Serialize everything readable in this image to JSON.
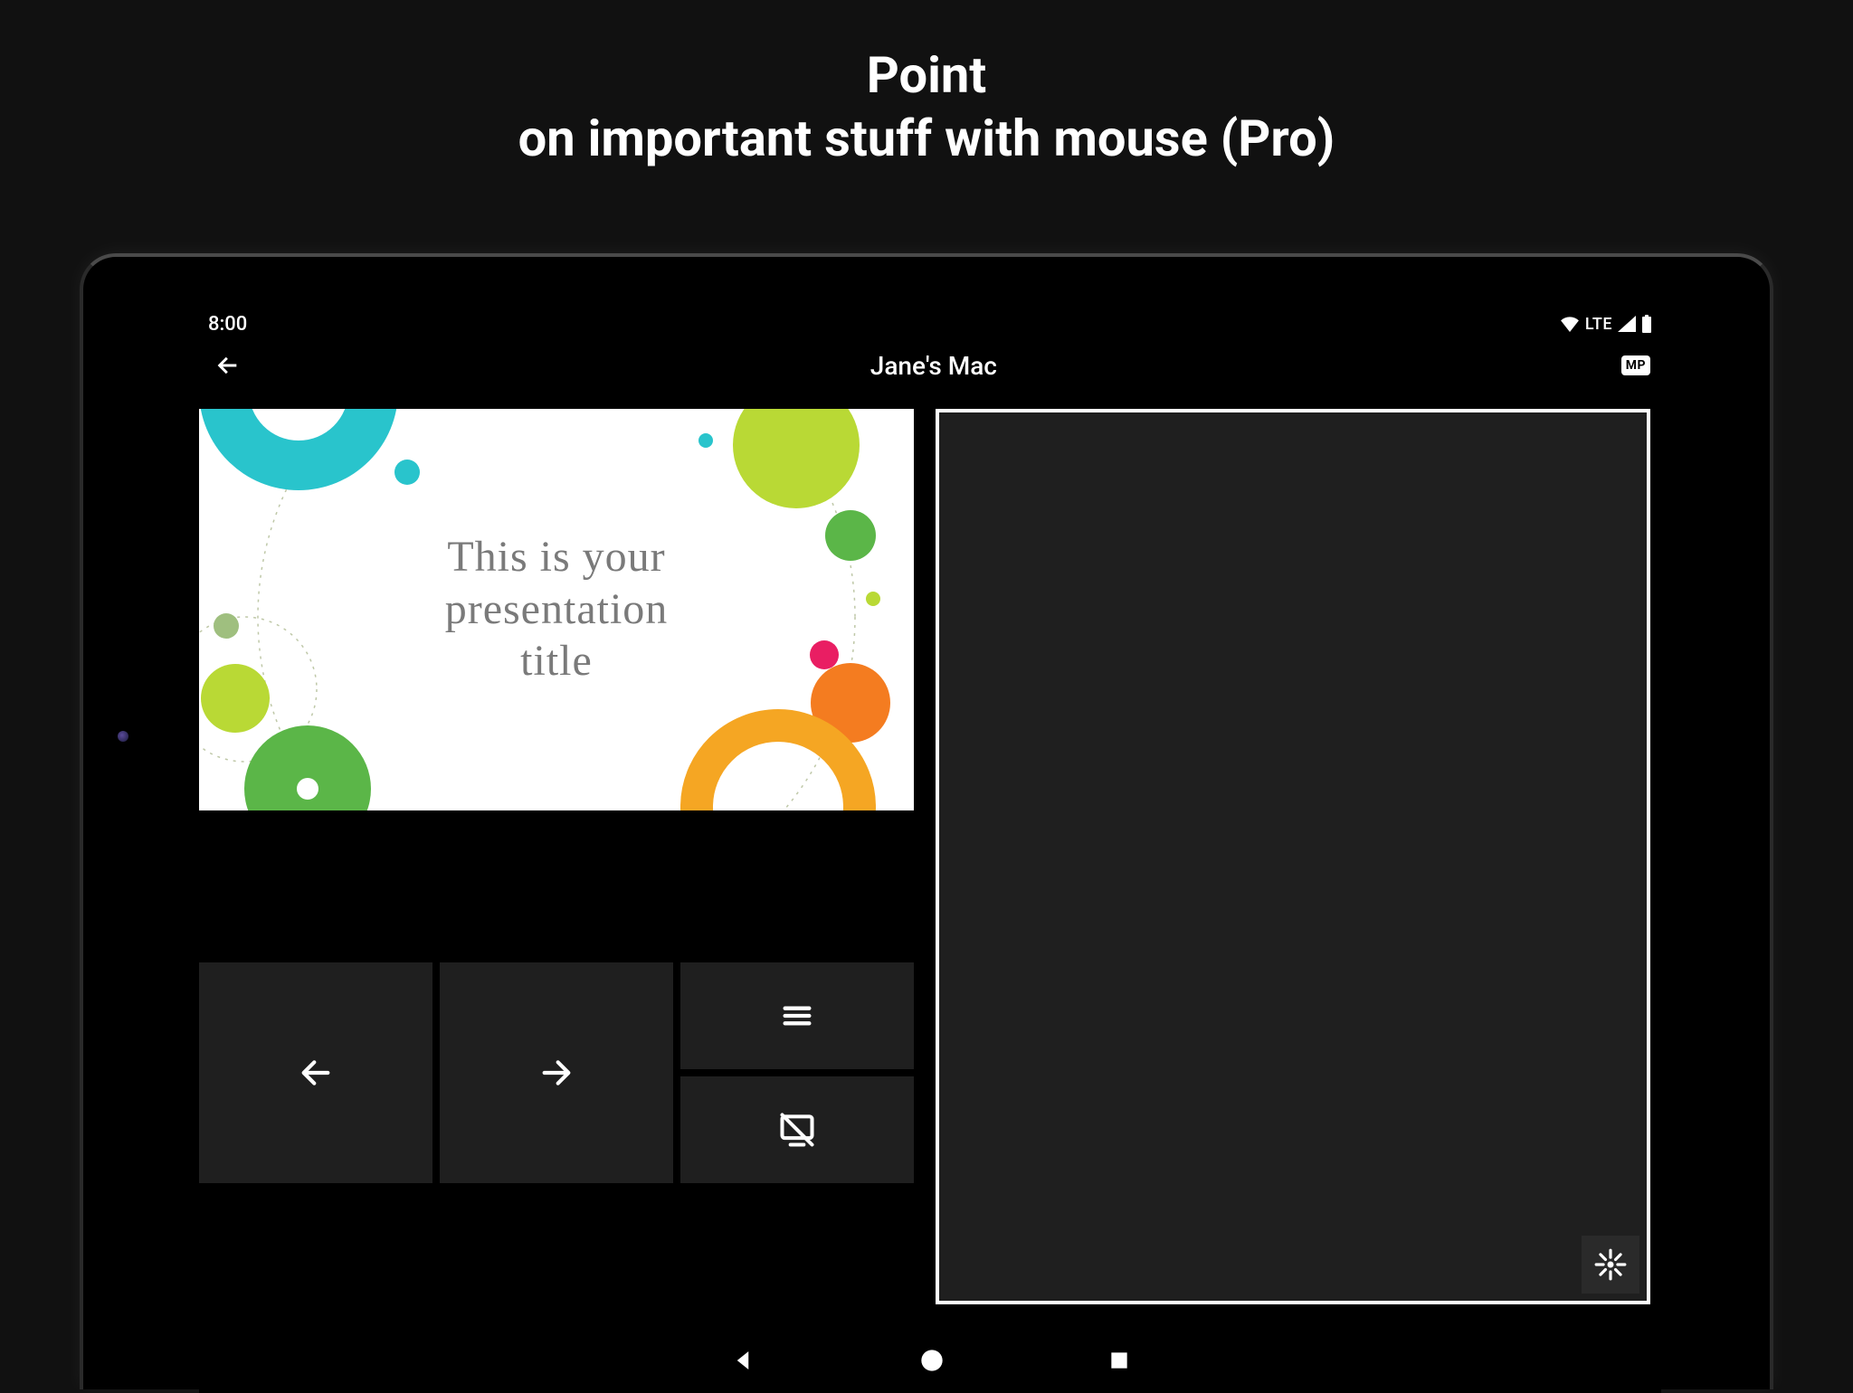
{
  "headline": {
    "line1": "Point",
    "line2": "on important stuff with mouse (Pro)"
  },
  "status_bar": {
    "time": "8:00",
    "network_label": "LTE"
  },
  "app_header": {
    "title": "Jane's Mac",
    "badge": "MP"
  },
  "slide": {
    "line1": "This is your",
    "line2": "presentation",
    "line3": "title"
  },
  "icons": {
    "back": "arrow-left",
    "prev": "arrow-left",
    "next": "arrow-right",
    "menu": "hamburger",
    "stop": "no-monitor",
    "laser": "burst"
  },
  "colors": {
    "teal": "#29c4cc",
    "lime": "#b9d935",
    "green": "#5bb648",
    "orange": "#f5a623",
    "orange_fill": "#f47c20",
    "pink": "#e91e63",
    "sage": "#9fbf7f"
  }
}
